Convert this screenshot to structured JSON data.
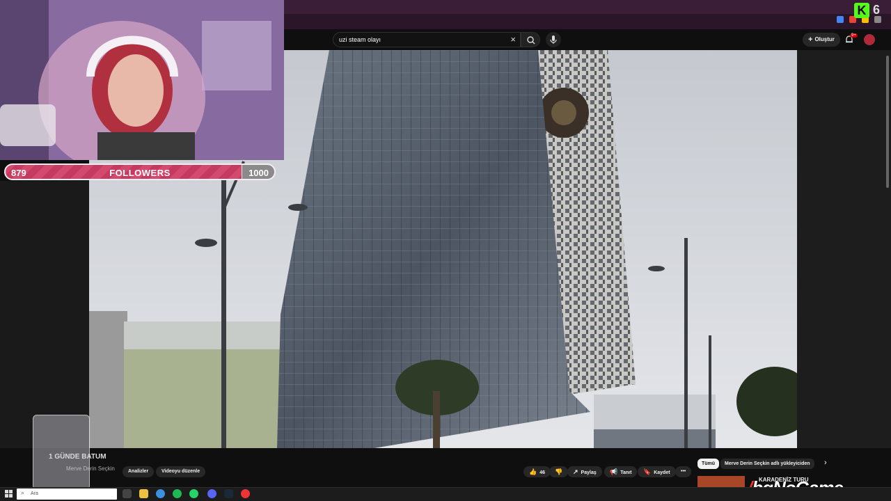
{
  "browser": {
    "extension_badge": "K",
    "extension_count": "6"
  },
  "youtube": {
    "search": {
      "value": "uzi steam olayı"
    },
    "create_label": "Oluştur",
    "notification_count": "9+"
  },
  "video": {
    "title": "1 GÜNDE BATUM",
    "channel": "Merve Derin Seçkin",
    "buttons": {
      "analytics": "Analizler",
      "edit": "Videoyu düzenle",
      "like_count": "46",
      "share": "Paylaş",
      "promote": "Tanıt",
      "save": "Kaydet",
      "more": "•••"
    }
  },
  "recommendations": {
    "chips": [
      "Tümü",
      "Merve Derin Seçkin adlı yükleyiciden"
    ],
    "first_title": "KARADENİZ TURU"
  },
  "stream_overlay": {
    "followers": {
      "current": "879",
      "label": "FOLLOWERS",
      "goal": "1000",
      "progress": 0.879
    },
    "watermark": "bgNoGame"
  },
  "taskbar": {
    "search_placeholder": "Ara"
  },
  "colors": {
    "kick_green": "#53fc18",
    "follower_fill": "#d24a6e",
    "youtube_bg": "#0f0f0f"
  }
}
